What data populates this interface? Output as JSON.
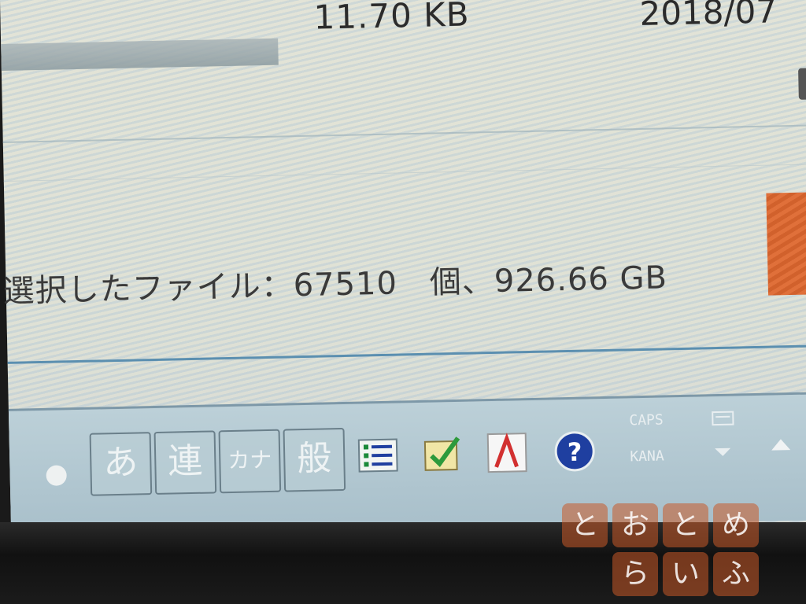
{
  "file_row": {
    "size": "11.70 KB",
    "date": "2018/07"
  },
  "status": {
    "text": "選択したファイル：67510　個、926.66 GB"
  },
  "taskbar": {
    "ime_buttons": [
      {
        "label": "あ"
      },
      {
        "label": "連"
      },
      {
        "label": "カナ"
      },
      {
        "label": "般"
      }
    ],
    "sys_top": "CAPS",
    "sys_bottom": "KANA"
  },
  "watermark": {
    "chars": [
      "と",
      "お",
      "と",
      "め",
      "ら",
      "い",
      "ふ"
    ]
  },
  "colors": {
    "accent_orange": "#e0703a",
    "help_blue": "#1f3fa0",
    "line_blue": "#5b8fb0"
  }
}
